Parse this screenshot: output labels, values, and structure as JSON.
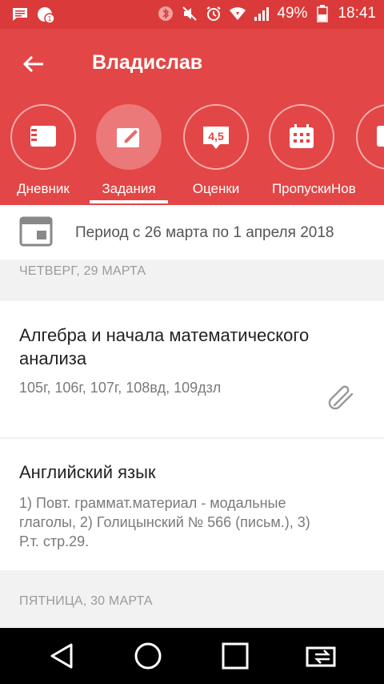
{
  "status_bar": {
    "battery_percent": "49%",
    "time": "18:41",
    "icons": [
      "message-icon",
      "notification-count-icon",
      "bluetooth-icon",
      "mute-icon",
      "alarm-icon",
      "wifi-icon",
      "signal-icon",
      "battery-icon"
    ]
  },
  "app_bar": {
    "title": "Владислав"
  },
  "tabs": [
    {
      "label": "Дневник",
      "icon": "book-icon",
      "active": false
    },
    {
      "label": "Задания",
      "icon": "edit-icon",
      "active": true
    },
    {
      "label": "Оценки",
      "icon": "grades-icon",
      "grade_text": "4,5",
      "active": false
    },
    {
      "label": "Пропуски",
      "icon": "calendar-icon",
      "active": false
    },
    {
      "label": "Нов",
      "icon": "news-icon",
      "active": false
    }
  ],
  "period": {
    "text": "Период с 26 марта по 1 апреля 2018"
  },
  "days": [
    {
      "header": "ЧЕТВЕРГ, 29 МАРТА",
      "items": [
        {
          "subject_line1": "Алгебра и начала математического",
          "subject_line2": "анализа",
          "task": "105г, 106г, 107г, 108вд, 109дзл",
          "has_attachment": true
        },
        {
          "subject_line1": "Английский язык",
          "task_line1": "1) Повт. грамм​ат.материал - модальные",
          "task_line2": "глаголы, 2) Голицынский № 566 (письм.), 3)",
          "task_line3": "Р.т. стр.29."
        }
      ]
    },
    {
      "header": "ПЯТНИЦА, 30 МАРТА"
    }
  ]
}
